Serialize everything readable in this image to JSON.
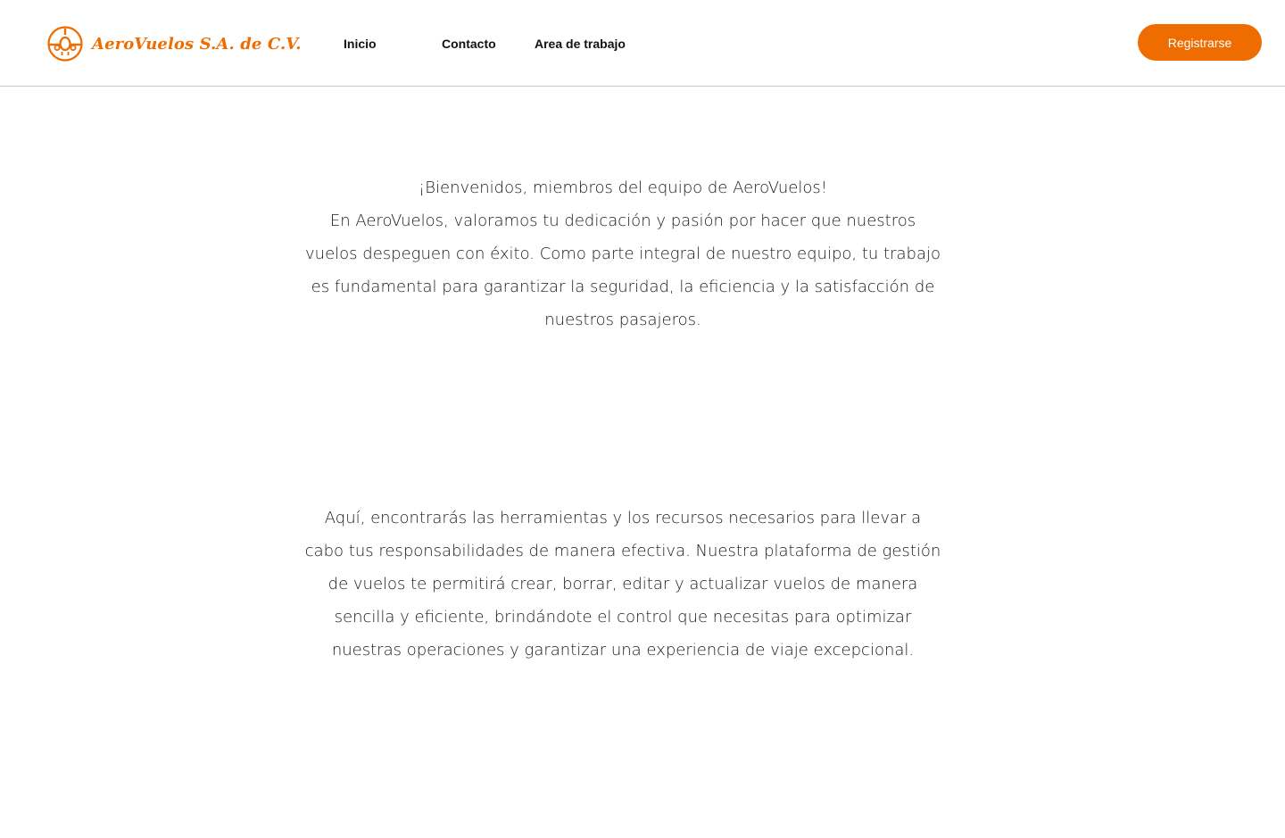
{
  "header": {
    "brand_name": "AeroVuelos S.A. de C.V.",
    "logo_icon": "airplane-front-icon",
    "nav": {
      "inicio": "Inicio",
      "contacto": "Contacto",
      "area": "Area de trabajo"
    },
    "register_label": "Registrarse"
  },
  "main": {
    "welcome_title": "¡Bienvenidos, miembros del equipo de AeroVuelos!",
    "welcome_body": "En AeroVuelos, valoramos tu dedicación y pasión por hacer que nuestros vuelos despeguen con éxito. Como parte integral de nuestro equipo, tu trabajo es fundamental para garantizar la seguridad, la eficiencia y la satisfacción de nuestros pasajeros.",
    "tools_body": "Aquí, encontrarás las herramientas y los recursos necesarios para llevar a cabo tus responsabilidades de manera efectiva. Nuestra plataforma de gestión de vuelos te permitirá crear, borrar, editar y actualizar vuelos de manera sencilla y eficiente, brindándote el control que necesitas para optimizar nuestras operaciones y garantizar una experiencia de viaje excepcional."
  },
  "colors": {
    "accent": "#ef6c00",
    "text": "#1a1a1a",
    "divider": "#c8c8c8"
  }
}
